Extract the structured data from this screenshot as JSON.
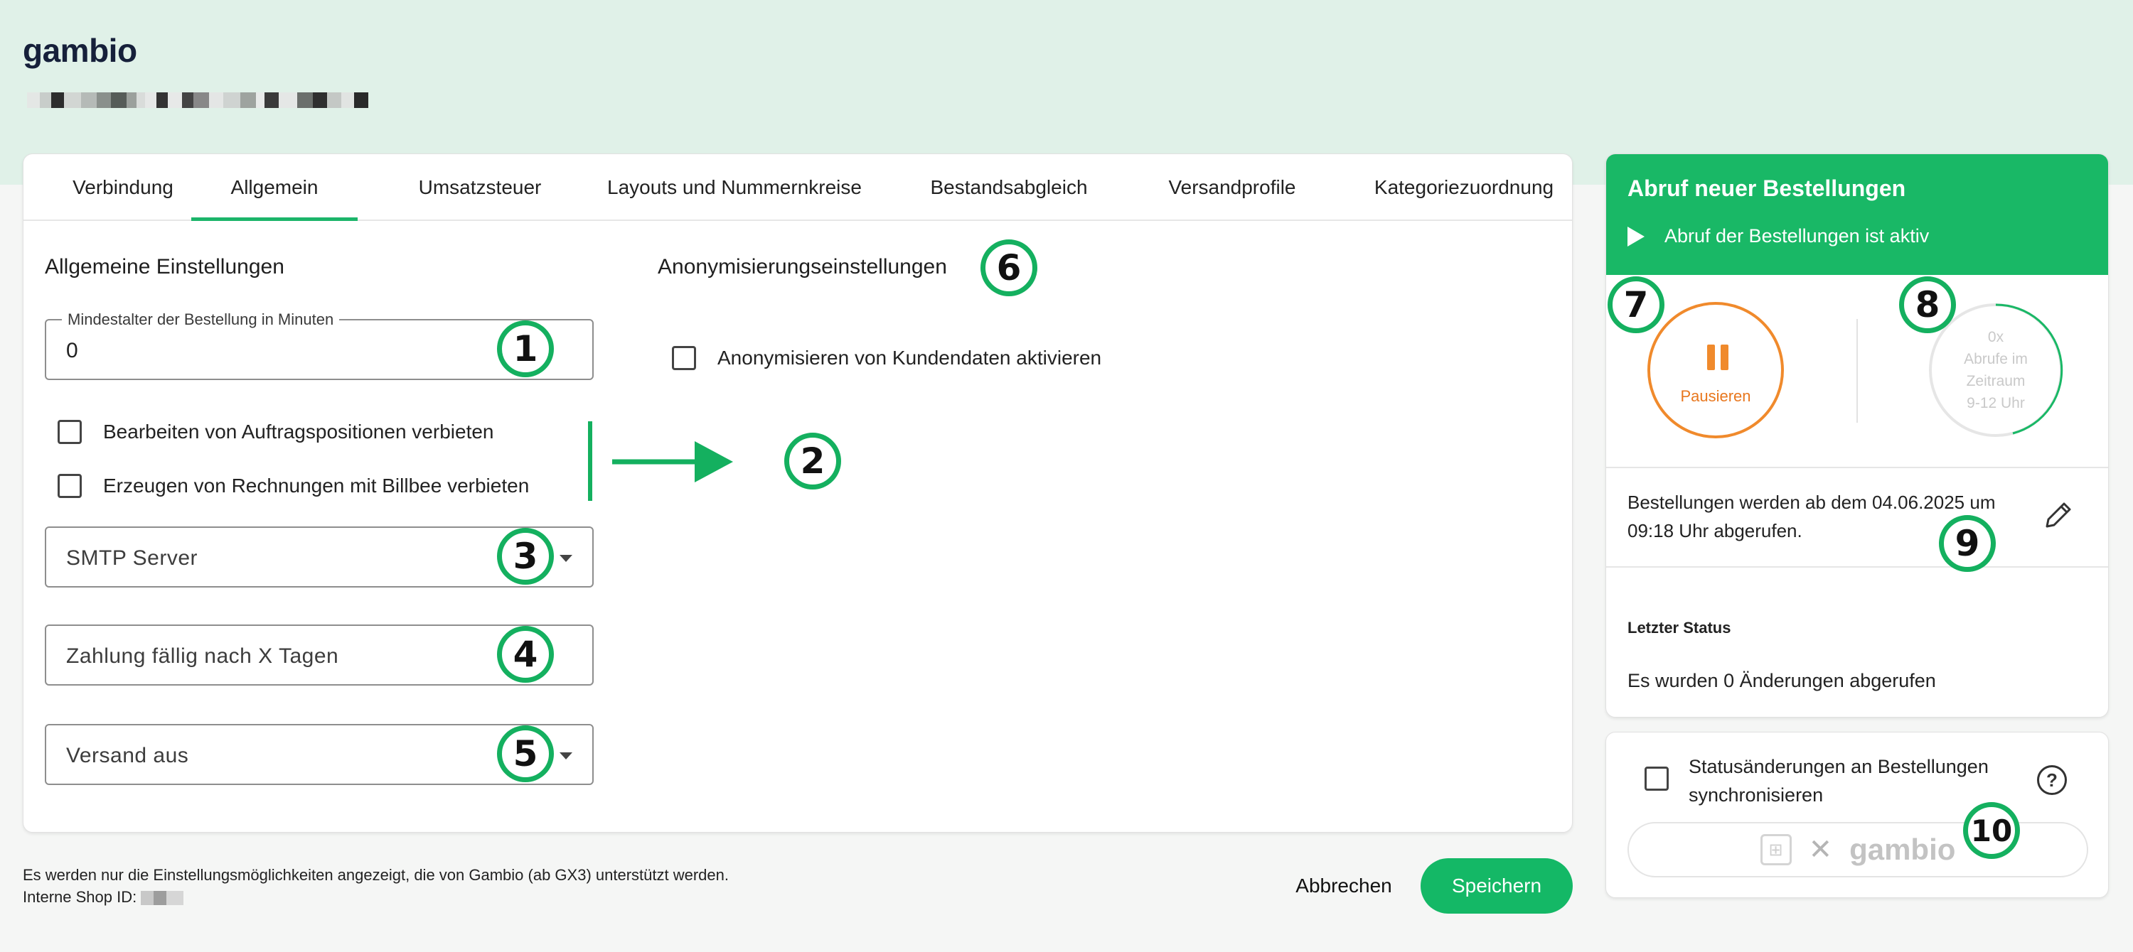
{
  "header": {
    "logo": "gambio",
    "blurred_shop_name": "redacted"
  },
  "tabs": [
    {
      "label": "Verbindung",
      "active": false
    },
    {
      "label": "Allgemein",
      "active": true
    },
    {
      "label": "Umsatzsteuer",
      "active": false
    },
    {
      "label": "Layouts und Nummernkreise",
      "active": false
    },
    {
      "label": "Bestandsabgleich",
      "active": false
    },
    {
      "label": "Versandprofile",
      "active": false
    },
    {
      "label": "Kategoriezuordnung",
      "active": false
    }
  ],
  "general": {
    "title": "Allgemeine Einstellungen",
    "min_age": {
      "label": "Mindestalter der Bestellung in Minuten",
      "value": "0"
    },
    "checkboxes": [
      {
        "label": "Bearbeiten von Auftragspositionen verbieten",
        "checked": false
      },
      {
        "label": "Erzeugen von Rechnungen mit Billbee verbieten",
        "checked": false
      }
    ],
    "smtp": {
      "placeholder": "SMTP Server"
    },
    "payment_due": {
      "placeholder": "Zahlung fällig nach X Tagen"
    },
    "shipping": {
      "placeholder": "Versand aus"
    }
  },
  "anonymization": {
    "title": "Anonymisierungseinstellungen",
    "checkbox_label": "Anonymisieren von Kundendaten aktivieren",
    "checked": false
  },
  "markers": [
    "1",
    "2",
    "3",
    "4",
    "5",
    "6",
    "7",
    "8",
    "9",
    "10"
  ],
  "footer": {
    "note": "Es werden nur die Einstellungsmöglichkeiten angezeigt, die von Gambio (ab GX3) unterstützt werden.",
    "shop_id_label": "Interne Shop ID:",
    "cancel_label": "Abbrechen",
    "save_label": "Speichern"
  },
  "order_fetch": {
    "title": "Abruf neuer Bestellungen",
    "status": "Abruf der Bestellungen ist aktiv",
    "pause_label": "Pausieren",
    "gauge_count": "0x",
    "gauge_line1": "Abrufe im",
    "gauge_line2": "Zeitraum",
    "gauge_line3": "9-12 Uhr",
    "fetch_text": "Bestellungen werden ab dem 04.06.2025 um 09:18 Uhr abgerufen.",
    "last_status_label": "Letzter Status",
    "last_status_value": "Es wurden 0 Änderungen abgerufen"
  },
  "sync": {
    "label": "Statusänderungen an Bestellungen synchronisieren",
    "checked": false,
    "connect_brand": "gambio",
    "connect_separator": "✕"
  },
  "colors": {
    "accent": "#19b866",
    "header_bg": "#e0f1e8",
    "pause_orange": "#f08a2c",
    "marker_green": "#14b05f"
  }
}
